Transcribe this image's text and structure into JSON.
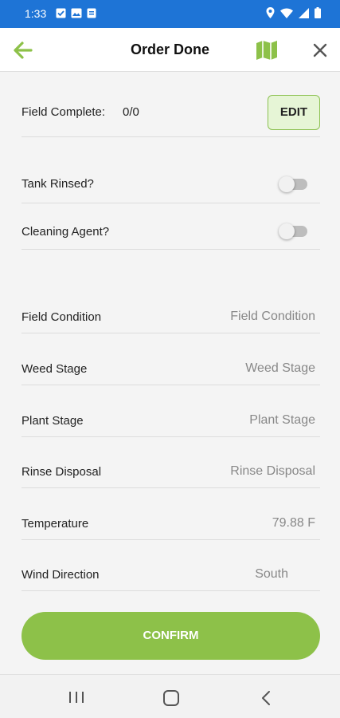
{
  "status_bar": {
    "time": "1:33",
    "left_icons": [
      "check-box-icon",
      "image-icon",
      "document-icon"
    ],
    "right_icons": [
      "location-icon",
      "wifi-icon",
      "signal-icon",
      "battery-icon"
    ]
  },
  "app_bar": {
    "title": "Order Done",
    "accent_color": "#8dc149"
  },
  "field_complete": {
    "label": "Field Complete:",
    "value": "0/0",
    "edit_label": "EDIT"
  },
  "toggles": {
    "tank_rinsed": {
      "label": "Tank Rinsed?",
      "on": false
    },
    "cleaning_agent": {
      "label": "Cleaning Agent?",
      "on": false
    }
  },
  "fields": {
    "field_condition": {
      "label": "Field Condition",
      "placeholder": "Field Condition"
    },
    "weed_stage": {
      "label": "Weed Stage",
      "placeholder": "Weed Stage"
    },
    "plant_stage": {
      "label": "Plant Stage",
      "placeholder": "Plant Stage"
    },
    "rinse_disposal": {
      "label": "Rinse Disposal",
      "placeholder": "Rinse Disposal"
    },
    "temperature": {
      "label": "Temperature",
      "value": "79.88 F"
    },
    "wind_direction": {
      "label": "Wind Direction",
      "value": "South"
    }
  },
  "confirm_label": "CONFIRM",
  "colors": {
    "status_bar": "#1e74d6",
    "confirm_button": "#8dc149",
    "edit_button_bg": "#e6f5d6"
  }
}
